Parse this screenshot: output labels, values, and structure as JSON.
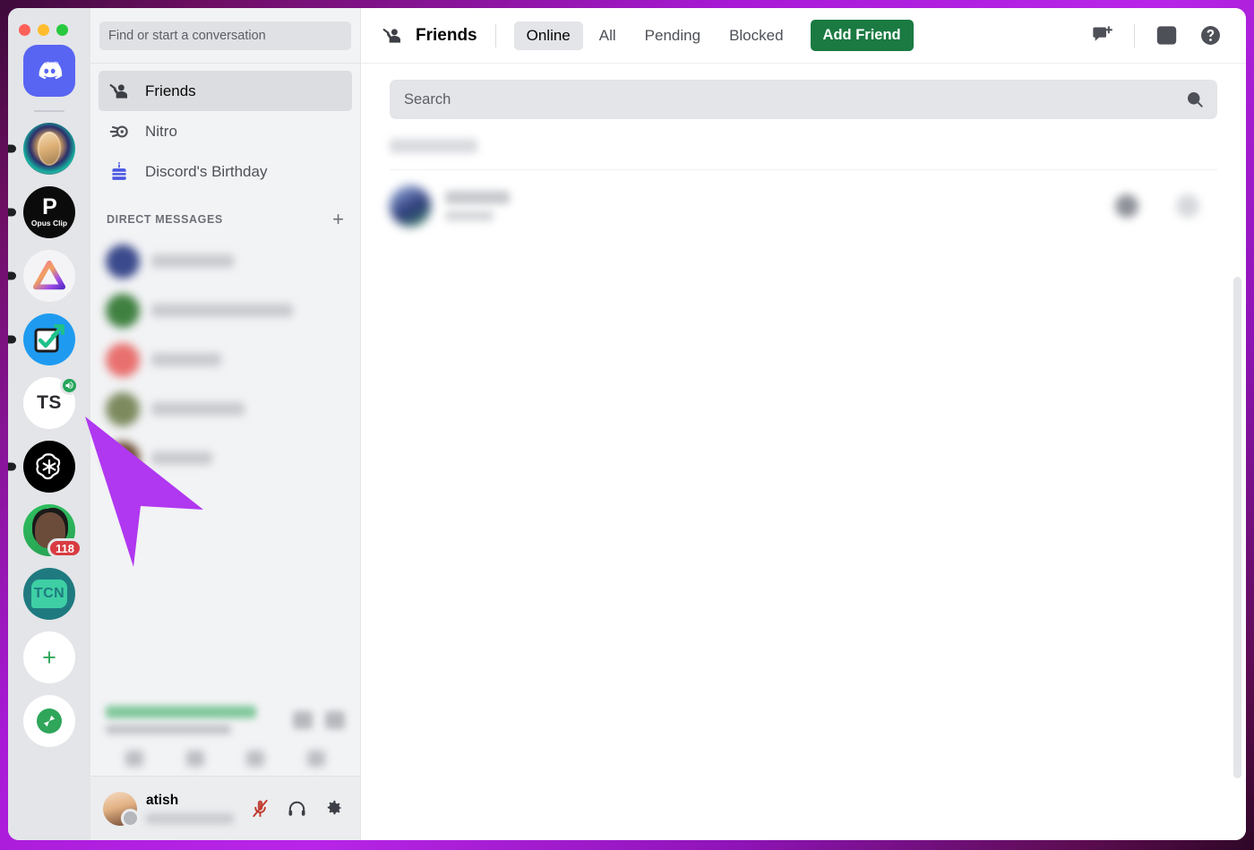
{
  "window": {
    "controls": [
      "close",
      "minimize",
      "maximize"
    ]
  },
  "server_rail": {
    "items": [
      {
        "name": "Discord Home",
        "icon": "discord-logo-icon",
        "shape": "squircle",
        "unread": false
      },
      {
        "name": "Artwork Server",
        "icon": "server-avatar-artwork",
        "unread": true
      },
      {
        "name": "Opus Clip",
        "icon": "server-avatar-opus-clip",
        "label_top": "P",
        "label_bottom": "Opus Clip",
        "unread": true
      },
      {
        "name": "The Verge",
        "icon": "server-avatar-verge",
        "unread": true
      },
      {
        "name": "Checklist Server",
        "icon": "server-avatar-checkbox",
        "unread": true
      },
      {
        "name": "TS",
        "icon": "server-avatar-ts",
        "label": "TS",
        "badge": "voice-connected",
        "unread": false
      },
      {
        "name": "OpenAI",
        "icon": "server-avatar-openai",
        "unread": true
      },
      {
        "name": "Personal Server",
        "icon": "server-avatar-person",
        "badge_count": "118",
        "unread": false
      },
      {
        "name": "TCN",
        "icon": "server-avatar-tcn",
        "label": "TCN",
        "unread": false
      },
      {
        "name": "Add a Server",
        "icon": "plus-icon",
        "label": "+",
        "unread": false
      },
      {
        "name": "Explore Public Servers",
        "icon": "compass-icon",
        "unread": false
      }
    ]
  },
  "sidebar": {
    "find_placeholder": "Find or start a conversation",
    "nav": [
      {
        "label": "Friends",
        "icon": "friends-wave-icon",
        "active": true
      },
      {
        "label": "Nitro",
        "icon": "nitro-icon",
        "active": false
      },
      {
        "label": "Discord's Birthday",
        "icon": "cake-icon",
        "active": false
      }
    ],
    "dm_section": {
      "title": "DIRECT MESSAGES",
      "add_label": "+",
      "conversations": [
        {
          "name_width": 92,
          "avatar": "#3b4a8c"
        },
        {
          "name_width": 158,
          "avatar": "#3f8040"
        },
        {
          "name_width": 78,
          "avatar": "#e8706e"
        },
        {
          "name_width": 104,
          "avatar": "#7c8a5e"
        },
        {
          "name_width": 68,
          "avatar": "#6b4a2e"
        }
      ]
    },
    "voice_panel": {
      "status_blurred": true
    }
  },
  "user_panel": {
    "username": "atish",
    "tag_blurred": true,
    "controls": [
      {
        "name": "mute-microphone",
        "icon": "microphone-muted-icon",
        "state": "muted"
      },
      {
        "name": "deafen",
        "icon": "headphones-icon",
        "state": "on"
      },
      {
        "name": "user-settings",
        "icon": "gear-icon",
        "state": "default"
      }
    ]
  },
  "main": {
    "header": {
      "title": "Friends",
      "title_icon": "friends-wave-icon",
      "tabs": [
        {
          "label": "Online",
          "active": true
        },
        {
          "label": "All",
          "active": false
        },
        {
          "label": "Pending",
          "active": false
        },
        {
          "label": "Blocked",
          "active": false
        }
      ],
      "add_friend_label": "Add Friend",
      "add_friend_color": "#1a7a42",
      "right_icons": [
        {
          "name": "new-group-dm-icon",
          "label": "New Group DM"
        },
        {
          "name": "inbox-icon",
          "label": "Inbox"
        },
        {
          "name": "help-icon",
          "label": "Help"
        }
      ]
    },
    "search": {
      "placeholder": "Search",
      "value": "",
      "icon": "search-icon"
    },
    "online_header_blurred": true,
    "friend_rows": [
      {
        "blurred": true,
        "actions": [
          "message-icon",
          "more-icon"
        ]
      }
    ]
  },
  "cursor": {
    "color": "#b038f0",
    "type": "arrow-pointer"
  },
  "frame": {
    "accent": "#b825e8"
  }
}
